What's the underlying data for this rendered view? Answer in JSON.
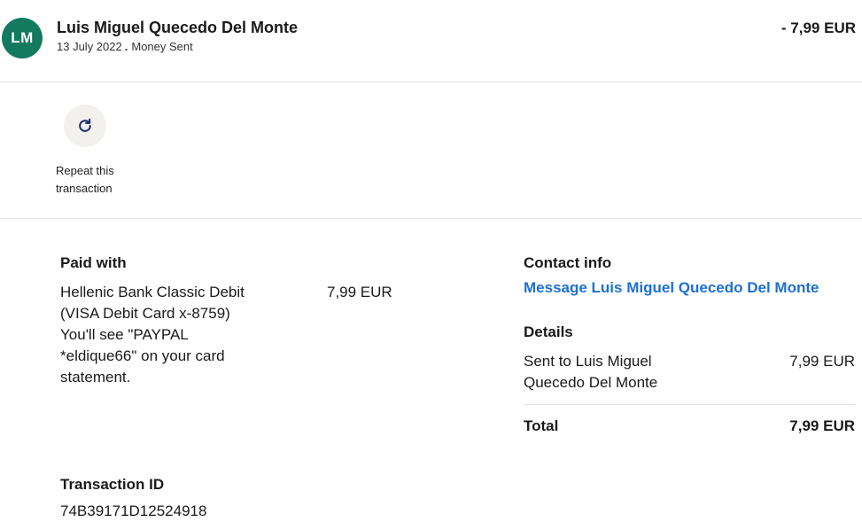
{
  "header": {
    "avatar_initials": "LM",
    "name": "Luis Miguel Quecedo Del Monte",
    "date": "13 July 2022",
    "separator": ".",
    "type": "Money Sent",
    "amount": "- 7,99 EUR"
  },
  "actions": {
    "repeat_icon": "refresh-icon",
    "repeat_label": "Repeat this transaction"
  },
  "paid_with": {
    "title": "Paid with",
    "method": "Hellenic Bank Classic Debit (VISA Debit Card x-8759) You'll see \"PAYPAL *eldique66\" on your card statement.",
    "amount": "7,99 EUR"
  },
  "transaction": {
    "title": "Transaction ID",
    "id": "74B39171D12524918"
  },
  "contact": {
    "title": "Contact info",
    "link": "Message Luis Miguel Quecedo Del Monte"
  },
  "details": {
    "title": "Details",
    "sent_to": "Sent to Luis Miguel Quecedo Del Monte",
    "sent_amount": "7,99 EUR",
    "total_label": "Total",
    "total_amount": "7,99 EUR"
  },
  "colors": {
    "avatar_bg": "#137a5f",
    "link": "#1d6fd6",
    "icon": "#1f2a6b"
  }
}
